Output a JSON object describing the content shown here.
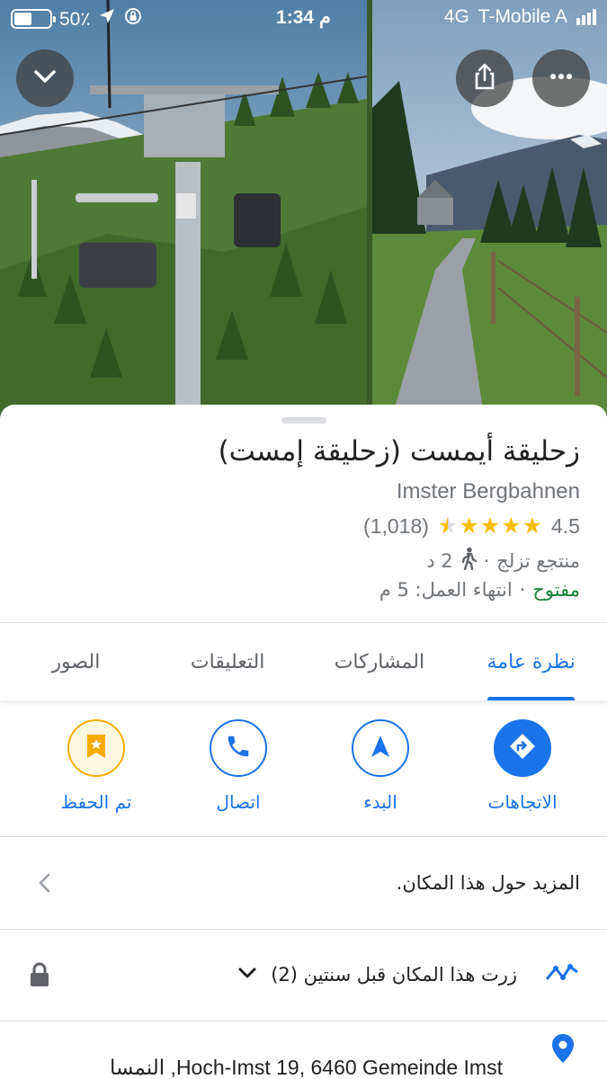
{
  "status_bar": {
    "battery": "50٪",
    "battery_level": 0.5,
    "time": "1:34 م",
    "network": "4G",
    "carrier": "T-Mobile A"
  },
  "icons": {
    "collapse": "chevron-down-icon",
    "share": "share-icon",
    "more": "more-horizontal-icon",
    "walk": "walking-person-icon",
    "directions": "directions-icon",
    "start": "navigation-arrow-icon",
    "call": "phone-icon",
    "saved": "bookmark-star-icon",
    "more_info": "chevron-left-icon",
    "visited": "timeline-icon",
    "lock": "lock-icon",
    "location": "location-pin-icon"
  },
  "place": {
    "title": "زحليقة أيمست (زحليقة إمست)",
    "subtitle": "Imster Bergbahnen",
    "rating": "4.5",
    "rating_value": 4.5,
    "reviews_count": "(1,018)",
    "category": "منتجع تزلج",
    "walk_time": "2 د",
    "open_status": "مفتوح",
    "closing": "انتهاء العمل: 5 م",
    "separator": "·"
  },
  "tabs": [
    {
      "label": "نظرة عامة",
      "active": true
    },
    {
      "label": "المشاركات",
      "active": false
    },
    {
      "label": "التعليقات",
      "active": false
    },
    {
      "label": "الصور",
      "active": false
    }
  ],
  "actions": [
    {
      "label": "الاتجاهات"
    },
    {
      "label": "البدء"
    },
    {
      "label": "اتصال"
    },
    {
      "label": "تم الحفظ"
    }
  ],
  "rows": {
    "about": "المزيد حول هذا المكان.",
    "visited": "زرت هذا المكان قبل سنتين (2)",
    "address": "Hoch-Imst 19, 6460 Gemeinde Imst, النمسا"
  },
  "colors": {
    "accent": "#1a73e8",
    "star": "#fbbc04",
    "open": "#188038",
    "muted": "#70757a"
  }
}
